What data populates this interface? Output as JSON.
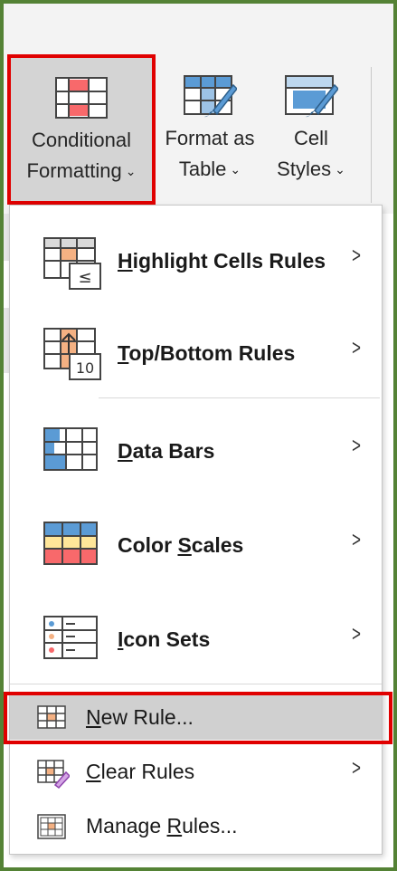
{
  "ribbon": {
    "conditional_formatting": {
      "line1": "Conditional",
      "line2": "Formatting"
    },
    "format_as_table": {
      "line1": "Format as",
      "line2": "Table"
    },
    "cell_styles": {
      "line1": "Cell",
      "line2": "Styles"
    }
  },
  "menu": {
    "items": [
      {
        "label_a": "H",
        "label_b": "ighlight Cells Rules",
        "icon": "highlight-cells-icon"
      },
      {
        "label_a": "T",
        "label_b": "op/Bottom Rules",
        "icon": "top-bottom-icon",
        "icon_text": "10"
      },
      {
        "label_a": "D",
        "label_b": "ata Bars",
        "icon": "data-bars-icon"
      },
      {
        "label_pre": "Color ",
        "label_a": "S",
        "label_b": "cales",
        "icon": "color-scales-icon"
      },
      {
        "label_a": "I",
        "label_b": "con Sets",
        "icon": "icon-sets-icon"
      }
    ],
    "new_rule": {
      "label_a": "N",
      "label_b": "ew Rule..."
    },
    "clear_rules": {
      "label_a": "C",
      "label_b": "lear Rules"
    },
    "manage_rules": {
      "label_pre": "Manage ",
      "label_a": "R",
      "label_b": "ules..."
    }
  },
  "colors": {
    "frame": "#548235",
    "highlight_red": "#e00000",
    "icon_blue": "#5b9bd5",
    "icon_orange": "#f4b183",
    "icon_red": "#f8696b"
  }
}
